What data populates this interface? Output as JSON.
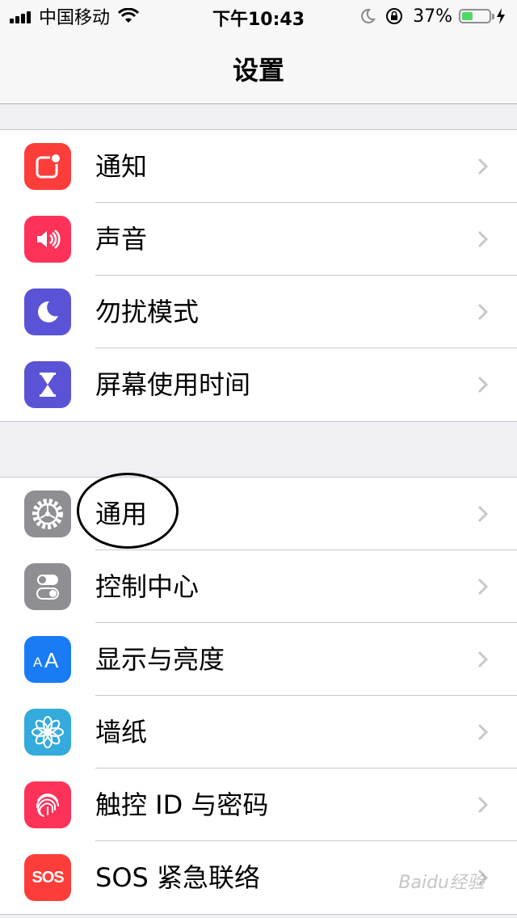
{
  "status_bar": {
    "carrier": "中国移动",
    "time": "下午10:43",
    "battery_percent": "37%",
    "battery_level": 0.37,
    "icons": [
      "signal-icon",
      "wifi-icon",
      "moon-icon",
      "orientation-lock-icon",
      "battery-icon",
      "charging-icon"
    ]
  },
  "navbar": {
    "title": "设置"
  },
  "groups": [
    {
      "rows": [
        {
          "label": "通知",
          "icon": "notifications-icon",
          "color": "#fd3d39"
        },
        {
          "label": "声音",
          "icon": "sounds-icon",
          "color": "#fd3259"
        },
        {
          "label": "勿扰模式",
          "icon": "do-not-disturb-icon",
          "color": "#5a53d6"
        },
        {
          "label": "屏幕使用时间",
          "icon": "screen-time-icon",
          "color": "#5a53d6"
        }
      ]
    },
    {
      "rows": [
        {
          "label": "通用",
          "icon": "general-gear-icon",
          "color": "#8e8e93"
        },
        {
          "label": "控制中心",
          "icon": "control-center-icon",
          "color": "#8e8e93"
        },
        {
          "label": "显示与亮度",
          "icon": "display-brightness-icon",
          "color": "#1a7cf5"
        },
        {
          "label": "墙纸",
          "icon": "wallpaper-icon",
          "color": "#35aadc"
        },
        {
          "label": "触控 ID 与密码",
          "icon": "touch-id-icon",
          "color": "#fd3259"
        },
        {
          "label": "SOS 紧急联络",
          "icon": "sos-icon",
          "color": "#fd3d39",
          "icon_text": "SOS"
        }
      ]
    }
  ],
  "annotation": {
    "type": "hand-drawn circle around 通用"
  },
  "watermark": "Baidu经验"
}
